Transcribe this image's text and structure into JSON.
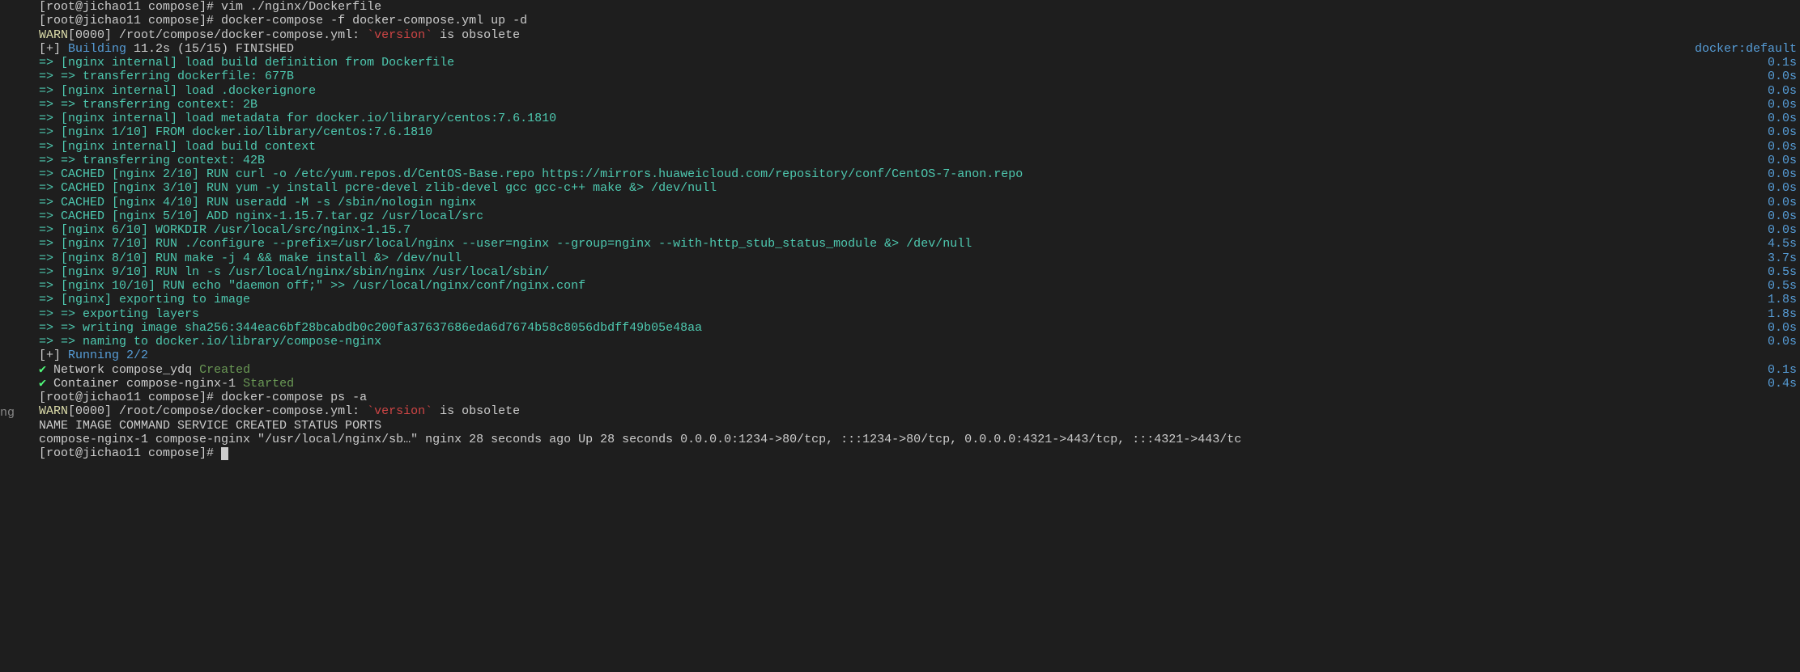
{
  "sidebar_hint": "ng",
  "lines": [
    {
      "segments": [
        {
          "t": "[root@jichao11 compose]# ",
          "c": "white"
        },
        {
          "t": "vim ./nginx/Dockerfile",
          "c": "white"
        }
      ]
    },
    {
      "segments": [
        {
          "t": "[root@jichao11 compose]# ",
          "c": "white"
        },
        {
          "t": "docker-compose -f docker-compose.yml up -d",
          "c": "white"
        }
      ]
    },
    {
      "segments": [
        {
          "t": "WARN",
          "c": "yellow"
        },
        {
          "t": "[0000] /root/compose/docker-compose.yml: ",
          "c": "white"
        },
        {
          "t": "`version`",
          "c": "red"
        },
        {
          "t": " is obsolete",
          "c": "white"
        }
      ]
    },
    {
      "segments": [
        {
          "t": "[+] ",
          "c": "white"
        },
        {
          "t": "Building ",
          "c": "blue"
        },
        {
          "t": "11.2s (15/15) FINISHED",
          "c": "white"
        }
      ],
      "right": {
        "t": "docker:default",
        "c": "blue"
      }
    },
    {
      "segments": [
        {
          "t": " => ",
          "c": "cyan"
        },
        {
          "t": "[nginx internal] load build definition from Dockerfile",
          "c": "cyan"
        }
      ],
      "right": {
        "t": "0.1s",
        "c": "blue"
      }
    },
    {
      "segments": [
        {
          "t": " => ",
          "c": "cyan"
        },
        {
          "t": "=> transferring dockerfile: 677B",
          "c": "cyan"
        }
      ],
      "right": {
        "t": "0.0s",
        "c": "blue"
      }
    },
    {
      "segments": [
        {
          "t": " => ",
          "c": "cyan"
        },
        {
          "t": "[nginx internal] load .dockerignore",
          "c": "cyan"
        }
      ],
      "right": {
        "t": "0.0s",
        "c": "blue"
      }
    },
    {
      "segments": [
        {
          "t": " => ",
          "c": "cyan"
        },
        {
          "t": "=> transferring context: 2B",
          "c": "cyan"
        }
      ],
      "right": {
        "t": "0.0s",
        "c": "blue"
      }
    },
    {
      "segments": [
        {
          "t": " => ",
          "c": "cyan"
        },
        {
          "t": "[nginx internal] load metadata for docker.io/library/centos:7.6.1810",
          "c": "cyan"
        }
      ],
      "right": {
        "t": "0.0s",
        "c": "blue"
      }
    },
    {
      "segments": [
        {
          "t": " => ",
          "c": "cyan"
        },
        {
          "t": "[nginx  1/10] FROM docker.io/library/centos:7.6.1810",
          "c": "cyan"
        }
      ],
      "right": {
        "t": "0.0s",
        "c": "blue"
      }
    },
    {
      "segments": [
        {
          "t": " => ",
          "c": "cyan"
        },
        {
          "t": "[nginx internal] load build context",
          "c": "cyan"
        }
      ],
      "right": {
        "t": "0.0s",
        "c": "blue"
      }
    },
    {
      "segments": [
        {
          "t": " => ",
          "c": "cyan"
        },
        {
          "t": "=> transferring context: 42B",
          "c": "cyan"
        }
      ],
      "right": {
        "t": "0.0s",
        "c": "blue"
      }
    },
    {
      "segments": [
        {
          "t": " => ",
          "c": "cyan"
        },
        {
          "t": "CACHED [nginx  2/10] RUN curl -o /etc/yum.repos.d/CentOS-Base.repo https://mirrors.huaweicloud.com/repository/conf/CentOS-7-anon.repo",
          "c": "cyan"
        }
      ],
      "right": {
        "t": "0.0s",
        "c": "blue"
      }
    },
    {
      "segments": [
        {
          "t": " => ",
          "c": "cyan"
        },
        {
          "t": "CACHED [nginx  3/10] RUN yum -y install pcre-devel zlib-devel gcc gcc-c++ make &> /dev/null",
          "c": "cyan"
        }
      ],
      "right": {
        "t": "0.0s",
        "c": "blue"
      }
    },
    {
      "segments": [
        {
          "t": " => ",
          "c": "cyan"
        },
        {
          "t": "CACHED [nginx  4/10] RUN useradd -M -s /sbin/nologin nginx",
          "c": "cyan"
        }
      ],
      "right": {
        "t": "0.0s",
        "c": "blue"
      }
    },
    {
      "segments": [
        {
          "t": " => ",
          "c": "cyan"
        },
        {
          "t": "CACHED [nginx  5/10] ADD nginx-1.15.7.tar.gz /usr/local/src",
          "c": "cyan"
        }
      ],
      "right": {
        "t": "0.0s",
        "c": "blue"
      }
    },
    {
      "segments": [
        {
          "t": " => ",
          "c": "cyan"
        },
        {
          "t": "[nginx  6/10] WORKDIR /usr/local/src/nginx-1.15.7",
          "c": "cyan"
        }
      ],
      "right": {
        "t": "0.0s",
        "c": "blue"
      }
    },
    {
      "segments": [
        {
          "t": " => ",
          "c": "cyan"
        },
        {
          "t": "[nginx  7/10] RUN ./configure --prefix=/usr/local/nginx --user=nginx --group=nginx --with-http_stub_status_module &> /dev/null",
          "c": "cyan"
        }
      ],
      "right": {
        "t": "4.5s",
        "c": "blue"
      }
    },
    {
      "segments": [
        {
          "t": " => ",
          "c": "cyan"
        },
        {
          "t": "[nginx  8/10] RUN make -j 4 && make install &> /dev/null",
          "c": "cyan"
        }
      ],
      "right": {
        "t": "3.7s",
        "c": "blue"
      }
    },
    {
      "segments": [
        {
          "t": " => ",
          "c": "cyan"
        },
        {
          "t": "[nginx  9/10] RUN ln -s /usr/local/nginx/sbin/nginx /usr/local/sbin/",
          "c": "cyan"
        }
      ],
      "right": {
        "t": "0.5s",
        "c": "blue"
      }
    },
    {
      "segments": [
        {
          "t": " => ",
          "c": "cyan"
        },
        {
          "t": "[nginx 10/10] RUN echo \"daemon off;\" >> /usr/local/nginx/conf/nginx.conf",
          "c": "cyan"
        }
      ],
      "right": {
        "t": "0.5s",
        "c": "blue"
      }
    },
    {
      "segments": [
        {
          "t": " => ",
          "c": "cyan"
        },
        {
          "t": "[nginx] exporting to image",
          "c": "cyan"
        }
      ],
      "right": {
        "t": "1.8s",
        "c": "blue"
      }
    },
    {
      "segments": [
        {
          "t": " => ",
          "c": "cyan"
        },
        {
          "t": "=> exporting layers",
          "c": "cyan"
        }
      ],
      "right": {
        "t": "1.8s",
        "c": "blue"
      }
    },
    {
      "segments": [
        {
          "t": " => ",
          "c": "cyan"
        },
        {
          "t": "=> writing image sha256:344eac6bf28bcabdb0c200fa37637686eda6d7674b58c8056dbdff49b05e48aa",
          "c": "cyan"
        }
      ],
      "right": {
        "t": "0.0s",
        "c": "blue"
      }
    },
    {
      "segments": [
        {
          "t": " => ",
          "c": "cyan"
        },
        {
          "t": "=> naming to docker.io/library/compose-nginx",
          "c": "cyan"
        }
      ],
      "right": {
        "t": "0.0s",
        "c": "blue"
      }
    },
    {
      "segments": [
        {
          "t": "[+] ",
          "c": "white"
        },
        {
          "t": "Running 2/2",
          "c": "blue"
        }
      ]
    },
    {
      "segments": [
        {
          "t": " ✔ ",
          "c": "bgreen"
        },
        {
          "t": "Network compose_ydq        ",
          "c": "white"
        },
        {
          "t": "Created",
          "c": "green"
        }
      ],
      "right": {
        "t": "0.1s",
        "c": "blue"
      }
    },
    {
      "segments": [
        {
          "t": " ✔ ",
          "c": "bgreen"
        },
        {
          "t": "Container compose-nginx-1  ",
          "c": "white"
        },
        {
          "t": "Started",
          "c": "green"
        }
      ],
      "right": {
        "t": "0.4s",
        "c": "blue"
      }
    },
    {
      "segments": [
        {
          "t": "[root@jichao11 compose]# ",
          "c": "white"
        },
        {
          "t": "docker-compose ps -a",
          "c": "white"
        }
      ]
    },
    {
      "segments": [
        {
          "t": "WARN",
          "c": "yellow"
        },
        {
          "t": "[0000] /root/compose/docker-compose.yml: ",
          "c": "white"
        },
        {
          "t": "`version`",
          "c": "red"
        },
        {
          "t": " is obsolete",
          "c": "white"
        }
      ]
    },
    {
      "segments": [
        {
          "t": "NAME              IMAGE           COMMAND                  SERVICE   CREATED          STATUS          PORTS",
          "c": "white"
        }
      ]
    },
    {
      "segments": [
        {
          "t": "compose-nginx-1   compose-nginx   \"/usr/local/nginx/sb…\"   nginx     28 seconds ago   Up 28 seconds   0.0.0.0:1234->80/tcp, :::1234->80/tcp, 0.0.0.0:4321->443/tcp, :::4321->443/tc",
          "c": "white"
        }
      ]
    },
    {
      "segments": [
        {
          "t": "[root@jichao11 compose]# ",
          "c": "white"
        }
      ],
      "cursor": true
    }
  ]
}
